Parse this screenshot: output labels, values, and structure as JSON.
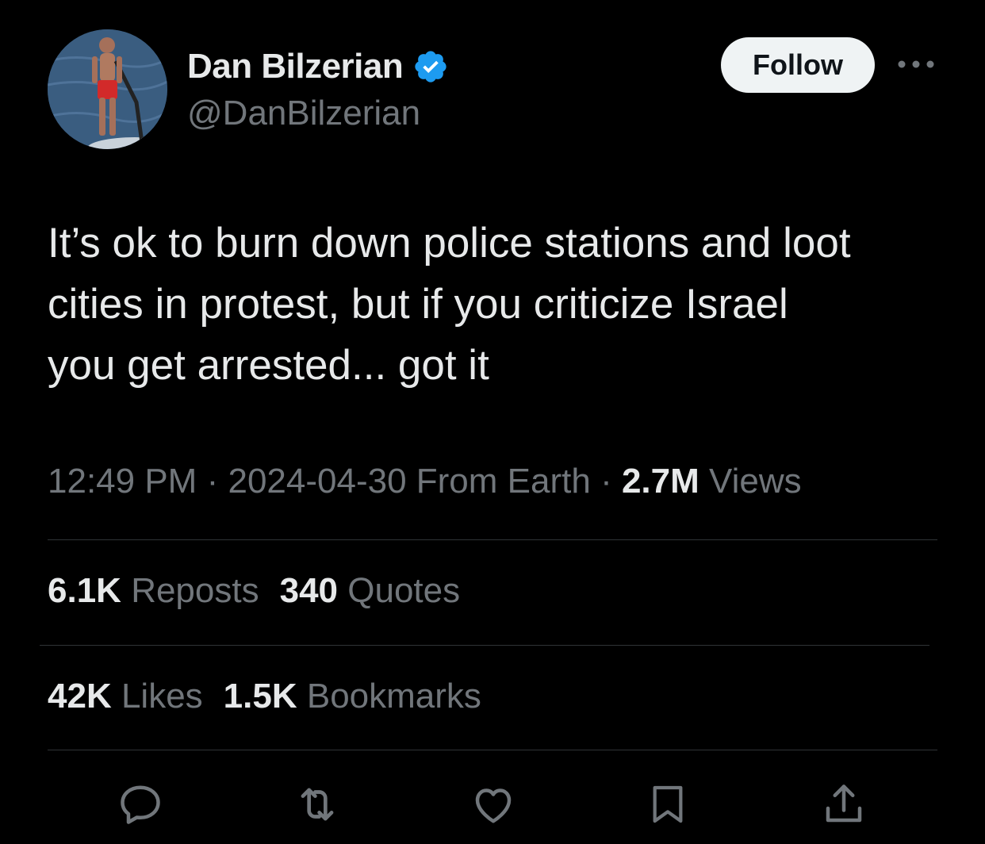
{
  "author": {
    "display_name": "Dan Bilzerian",
    "handle": "@DanBilzerian",
    "verified": true,
    "verified_color": "#1d9bf0"
  },
  "header": {
    "follow_label": "Follow",
    "more_icon": "more-horizontal-icon"
  },
  "tweet": {
    "text": "It’s ok to burn down police stations and loot\ncities in protest, but if you criticize Israel\nyou get arrested... got it"
  },
  "meta": {
    "time": "12:49 PM",
    "separator": "·",
    "date": "2024-04-30",
    "source": "From Earth",
    "views_count": "2.7M",
    "views_label": "Views"
  },
  "stats": {
    "reposts_count": "6.1K",
    "reposts_label": "Reposts",
    "quotes_count": "340",
    "quotes_label": "Quotes",
    "likes_count": "42K",
    "likes_label": "Likes",
    "bookmarks_count": "1.5K",
    "bookmarks_label": "Bookmarks"
  },
  "actions": {
    "icons": [
      "reply-icon",
      "repost-icon",
      "like-icon",
      "bookmark-icon",
      "share-icon"
    ]
  },
  "colors": {
    "background": "#000000",
    "primary_text": "#e7e9ea",
    "secondary_text": "#71767b",
    "divider": "#2f3336"
  }
}
